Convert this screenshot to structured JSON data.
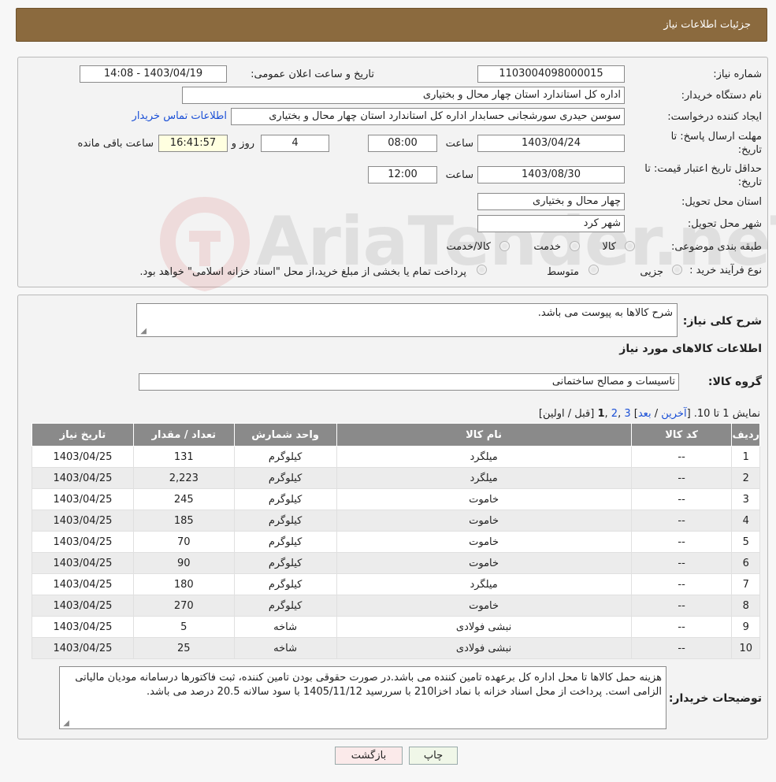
{
  "header": {
    "title": "جزئیات اطلاعات نیاز"
  },
  "form": {
    "need_number_label": "شماره نیاز:",
    "need_number": "1103004098000015",
    "announce_label": "تاریخ و ساعت اعلان عمومی:",
    "announce_value": "1403/04/19 - 14:08",
    "buyer_org_label": "نام دستگاه خریدار:",
    "buyer_org": "اداره کل استاندارد استان چهار محال و بختیاری",
    "creator_label": "ایجاد کننده درخواست:",
    "creator": "سوسن حیدری سورشجانی حسابدار اداره کل استاندارد استان چهار محال و بختیاری",
    "contact_link": "اطلاعات تماس خریدار",
    "reply_deadline_label_1": "مهلت ارسال پاسخ: تا",
    "reply_deadline_label_2": "تاریخ:",
    "reply_date": "1403/04/24",
    "time_label": "ساعت",
    "reply_time": "08:00",
    "days_value": "4",
    "day_label": "روز و",
    "remaining_time": "16:41:57",
    "remaining_label": "ساعت باقی مانده",
    "validity_label_1": "حداقل تاریخ اعتبار قیمت: تا",
    "validity_label_2": "تاریخ:",
    "validity_date": "1403/08/30",
    "validity_time": "12:00",
    "province_label": "استان محل تحویل:",
    "province": "چهار محال و بختیاری",
    "city_label": "شهر محل تحویل:",
    "city": "شهر کرد",
    "category_label": "طبقه بندی موضوعی:",
    "category_options": [
      "کالا",
      "خدمت",
      "کالا/خدمت"
    ],
    "process_label": "نوع فرآیند خرید :",
    "process_options": [
      "جزیی",
      "متوسط"
    ],
    "process_note": "پرداخت تمام یا بخشی از مبلغ خرید،از محل \"اسناد خزانه اسلامی\" خواهد بود."
  },
  "watermark": {
    "text": "AriaTender.neT"
  },
  "details": {
    "desc_label": "شرح کلی نیاز:",
    "desc_value": "شرح کالاها به پیوست می باشد.",
    "goods_info_title": "اطلاعات کالاهای مورد نیاز",
    "group_label": "گروه کالا:",
    "group_value": "تاسیسات و مصالح ساختمانی",
    "pagination": {
      "prefix": "نمایش 1 تا 10. [",
      "last": "آخرین",
      "sep1": " / ",
      "next": "بعد",
      "sep2": "] ",
      "p3": "3",
      "comma1": " ,",
      "p2": "2",
      "comma2": " ,",
      "p1": "1",
      "suffix": " [قبل / اولین]"
    },
    "columns": [
      "ردیف",
      "کد کالا",
      "نام کالا",
      "واحد شمارش",
      "تعداد / مقدار",
      "تاریخ نیاز"
    ],
    "rows": [
      [
        "1",
        "--",
        "میلگرد",
        "کیلوگرم",
        "131",
        "1403/04/25"
      ],
      [
        "2",
        "--",
        "میلگرد",
        "کیلوگرم",
        "2,223",
        "1403/04/25"
      ],
      [
        "3",
        "--",
        "خاموت",
        "کیلوگرم",
        "245",
        "1403/04/25"
      ],
      [
        "4",
        "--",
        "خاموت",
        "کیلوگرم",
        "185",
        "1403/04/25"
      ],
      [
        "5",
        "--",
        "خاموت",
        "کیلوگرم",
        "70",
        "1403/04/25"
      ],
      [
        "6",
        "--",
        "خاموت",
        "کیلوگرم",
        "90",
        "1403/04/25"
      ],
      [
        "7",
        "--",
        "میلگرد",
        "کیلوگرم",
        "180",
        "1403/04/25"
      ],
      [
        "8",
        "--",
        "خاموت",
        "کیلوگرم",
        "270",
        "1403/04/25"
      ],
      [
        "9",
        "--",
        "نبشی فولادی",
        "شاخه",
        "5",
        "1403/04/25"
      ],
      [
        "10",
        "--",
        "نبشی فولادی",
        "شاخه",
        "25",
        "1403/04/25"
      ]
    ],
    "buyer_notes_label": "توضیحات خریدار:",
    "buyer_notes": "هزینه حمل کالاها تا محل اداره کل برعهده تامین کننده می باشد.در صورت حقوقی بودن تامین کننده، ثبت فاکتورها درسامانه مودیان مالیاتی الزامی است. پرداخت از محل اسناد خزانه با نماد اخزا210 با سررسید 1405/11/12 با سود سالانه 20.5 درصد می باشد."
  },
  "buttons": {
    "print": "چاپ",
    "back": "بازگشت"
  }
}
